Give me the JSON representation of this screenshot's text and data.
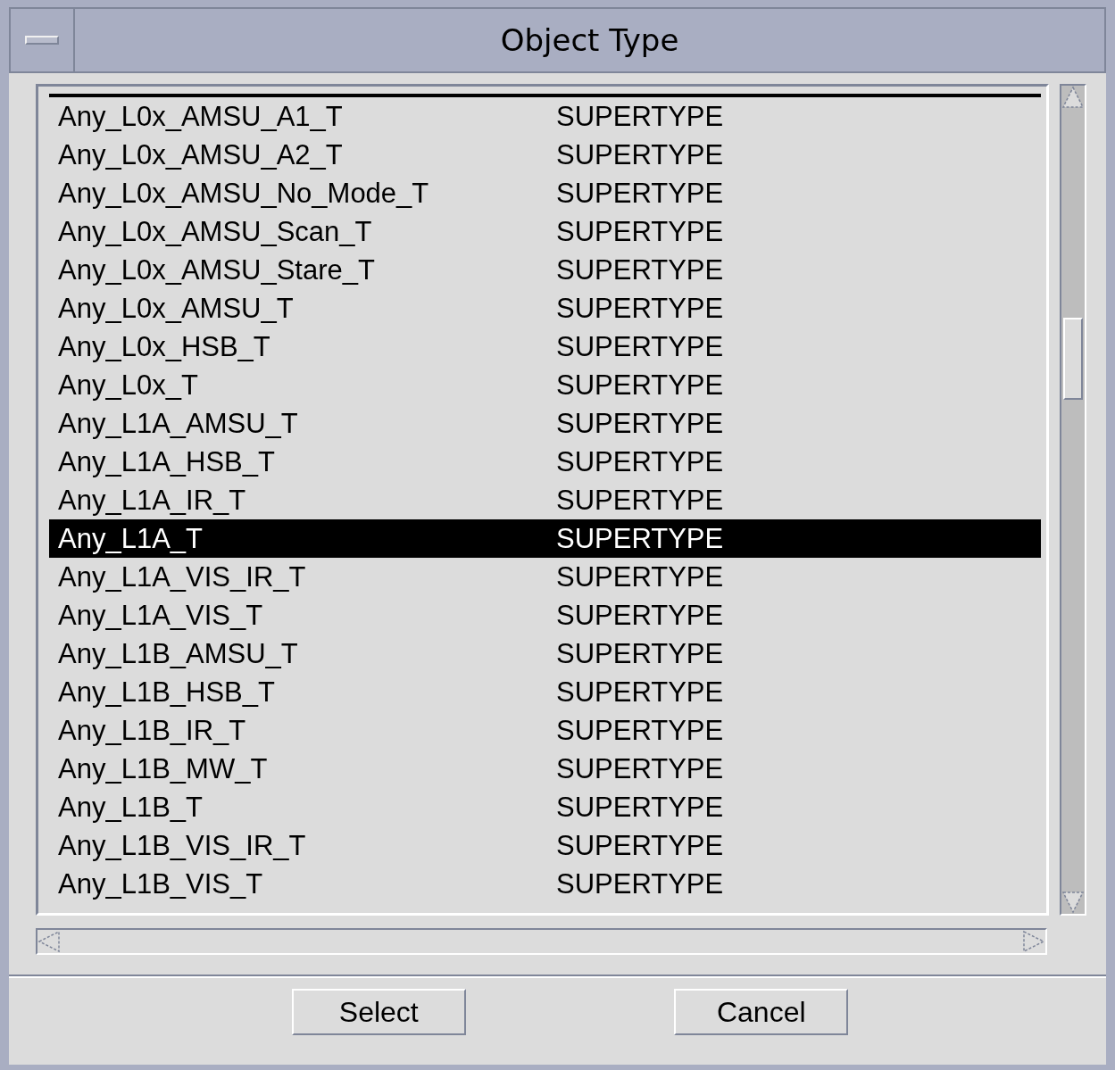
{
  "window": {
    "title": "Object Type"
  },
  "list": {
    "rows": [
      {
        "name": "Any_L0x_AMSU_A1_T",
        "type": "SUPERTYPE",
        "selected": false
      },
      {
        "name": "Any_L0x_AMSU_A2_T",
        "type": "SUPERTYPE",
        "selected": false
      },
      {
        "name": "Any_L0x_AMSU_No_Mode_T",
        "type": "SUPERTYPE",
        "selected": false
      },
      {
        "name": "Any_L0x_AMSU_Scan_T",
        "type": "SUPERTYPE",
        "selected": false
      },
      {
        "name": "Any_L0x_AMSU_Stare_T",
        "type": "SUPERTYPE",
        "selected": false
      },
      {
        "name": "Any_L0x_AMSU_T",
        "type": "SUPERTYPE",
        "selected": false
      },
      {
        "name": "Any_L0x_HSB_T",
        "type": "SUPERTYPE",
        "selected": false
      },
      {
        "name": "Any_L0x_T",
        "type": "SUPERTYPE",
        "selected": false
      },
      {
        "name": "Any_L1A_AMSU_T",
        "type": "SUPERTYPE",
        "selected": false
      },
      {
        "name": "Any_L1A_HSB_T",
        "type": "SUPERTYPE",
        "selected": false
      },
      {
        "name": "Any_L1A_IR_T",
        "type": "SUPERTYPE",
        "selected": false
      },
      {
        "name": "Any_L1A_T",
        "type": "SUPERTYPE",
        "selected": true
      },
      {
        "name": "Any_L1A_VIS_IR_T",
        "type": "SUPERTYPE",
        "selected": false
      },
      {
        "name": "Any_L1A_VIS_T",
        "type": "SUPERTYPE",
        "selected": false
      },
      {
        "name": "Any_L1B_AMSU_T",
        "type": "SUPERTYPE",
        "selected": false
      },
      {
        "name": "Any_L1B_HSB_T",
        "type": "SUPERTYPE",
        "selected": false
      },
      {
        "name": "Any_L1B_IR_T",
        "type": "SUPERTYPE",
        "selected": false
      },
      {
        "name": "Any_L1B_MW_T",
        "type": "SUPERTYPE",
        "selected": false
      },
      {
        "name": "Any_L1B_T",
        "type": "SUPERTYPE",
        "selected": false
      },
      {
        "name": "Any_L1B_VIS_IR_T",
        "type": "SUPERTYPE",
        "selected": false
      },
      {
        "name": "Any_L1B_VIS_T",
        "type": "SUPERTYPE",
        "selected": false
      }
    ]
  },
  "buttons": [
    {
      "label": "Select"
    },
    {
      "label": "Cancel"
    }
  ]
}
